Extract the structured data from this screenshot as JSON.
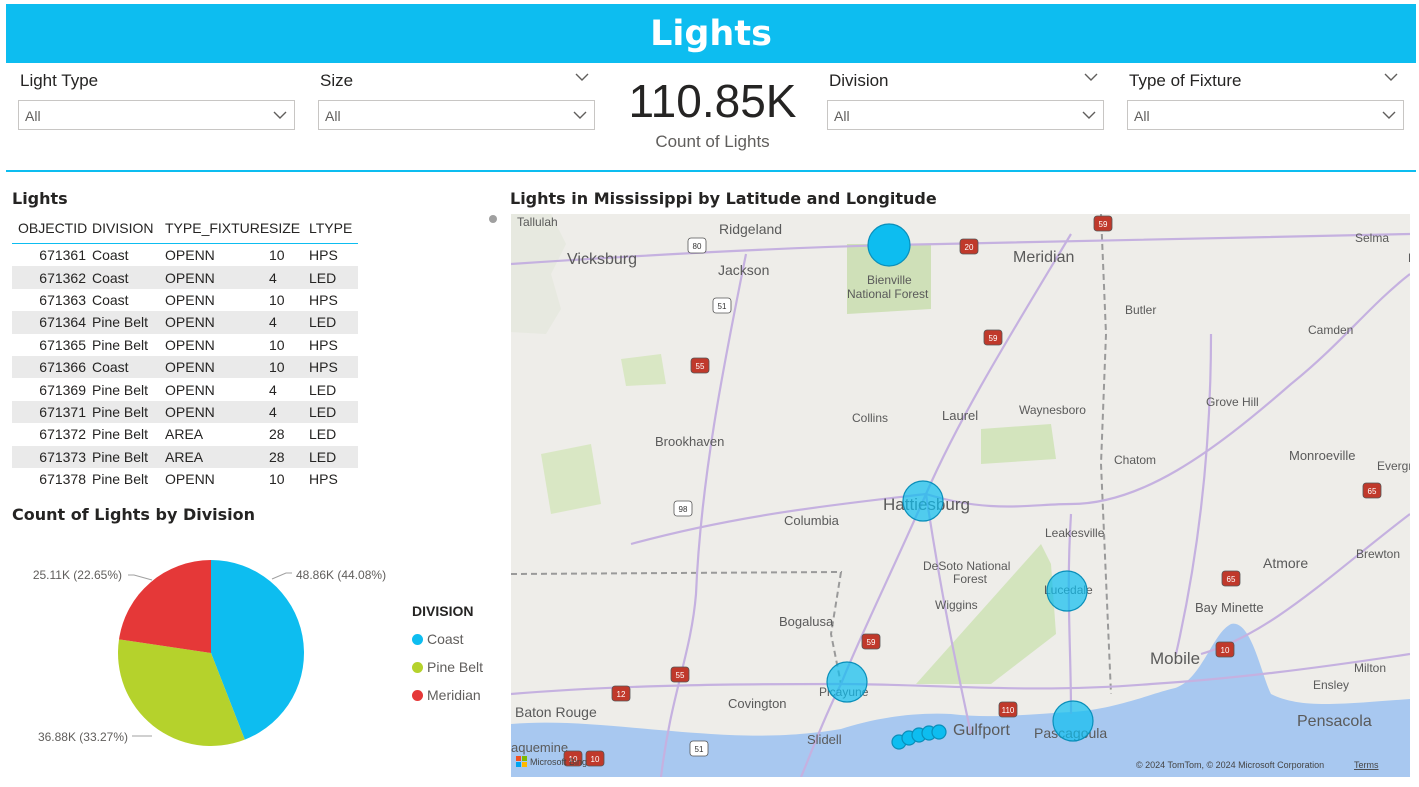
{
  "header": {
    "title": "Lights"
  },
  "slicers": [
    {
      "label": "Light Type",
      "value": "All"
    },
    {
      "label": "Size",
      "value": "All"
    },
    {
      "label": "Division",
      "value": "All"
    },
    {
      "label": "Type of Fixture",
      "value": "All"
    }
  ],
  "kpi": {
    "value": "110.85K",
    "caption": "Count of Lights"
  },
  "table": {
    "title": "Lights",
    "columns": [
      "OBJECTID",
      "DIVISION",
      "TYPE_FIXTURE",
      "SIZE",
      "LTYPE"
    ],
    "rows": [
      [
        "671361",
        "Coast",
        "OPENN",
        "10",
        "HPS"
      ],
      [
        "671362",
        "Coast",
        "OPENN",
        "4",
        "LED"
      ],
      [
        "671363",
        "Coast",
        "OPENN",
        "10",
        "HPS"
      ],
      [
        "671364",
        "Pine Belt",
        "OPENN",
        "4",
        "LED"
      ],
      [
        "671365",
        "Pine Belt",
        "OPENN",
        "10",
        "HPS"
      ],
      [
        "671366",
        "Coast",
        "OPENN",
        "10",
        "HPS"
      ],
      [
        "671369",
        "Pine Belt",
        "OPENN",
        "4",
        "LED"
      ],
      [
        "671371",
        "Pine Belt",
        "OPENN",
        "4",
        "LED"
      ],
      [
        "671372",
        "Pine Belt",
        "AREA",
        "28",
        "LED"
      ],
      [
        "671373",
        "Pine Belt",
        "AREA",
        "28",
        "LED"
      ],
      [
        "671378",
        "Pine Belt",
        "OPENN",
        "10",
        "HPS"
      ]
    ]
  },
  "chart_data": {
    "type": "pie",
    "title": "Count of Lights by Division",
    "legend_title": "DIVISION",
    "legend_position": "right",
    "slices": [
      {
        "name": "Coast",
        "value": 48.86,
        "percent": 44.08,
        "label": "48.86K (44.08%)",
        "color": "#0dbdf0"
      },
      {
        "name": "Pine Belt",
        "value": 36.88,
        "percent": 33.27,
        "label": "36.88K (33.27%)",
        "color": "#b5d22c"
      },
      {
        "name": "Meridian",
        "value": 25.11,
        "percent": 22.65,
        "label": "25.11K (22.65%)",
        "color": "#e53838"
      }
    ]
  },
  "map": {
    "title": "Lights in Mississippi by Latitude and Longitude",
    "attribution": "© 2024 TomTom, © 2024 Microsoft Corporation",
    "terms_label": "Terms",
    "logo_text": "Microsoft Bing",
    "places": [
      "Tallulah",
      "Vicksburg",
      "Ridgeland",
      "Jackson",
      "Bienville",
      "National Forest",
      "Meridian",
      "Selma",
      "Linden",
      "Butler",
      "Camden",
      "Collins",
      "Laurel",
      "Waynesboro",
      "Grove Hill",
      "Brookhaven",
      "Chatom",
      "Monroeville",
      "Evergr",
      "Hattiesburg",
      "Columbia",
      "Leakesville",
      "Brewton",
      "DeSoto National",
      "Forest",
      "Atmore",
      "Lucedale",
      "Bogalusa",
      "Wiggins",
      "Bay Minette",
      "Mobile",
      "Milton",
      "Picayune",
      "Ensley",
      "Covington",
      "Baton Rouge",
      "Pensacola",
      "Slidell",
      "Gulfport",
      "Pascagoula",
      "aquemine"
    ],
    "highways": [
      "80",
      "20",
      "59",
      "51",
      "59",
      "55",
      "98",
      "65",
      "65",
      "59",
      "55",
      "12",
      "10",
      "110",
      "10",
      "51",
      "10"
    ],
    "marker_color": "#0dbdf0"
  }
}
